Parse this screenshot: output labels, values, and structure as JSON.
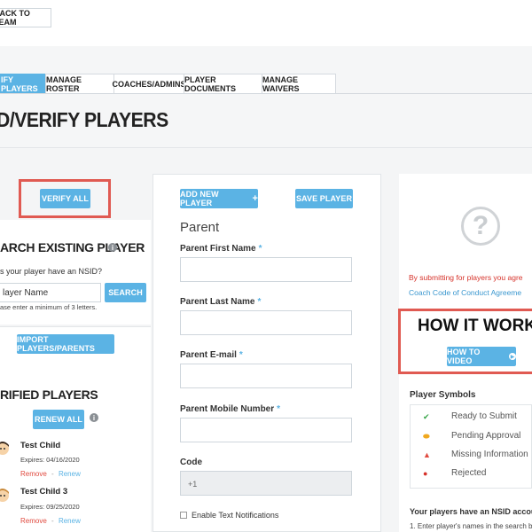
{
  "header": {
    "back_label": "BACK TO TEAM"
  },
  "tabs": [
    {
      "label": "IFY PLAYERS",
      "active": true
    },
    {
      "label": "MANAGE ROSTER",
      "active": false
    },
    {
      "label": "COACHES/ADMINS",
      "active": false
    },
    {
      "label": "PLAYER DOCUMENTS",
      "active": false
    },
    {
      "label": "MANAGE WAIVERS",
      "active": false
    }
  ],
  "page_title": "D/VERIFY PLAYERS",
  "left": {
    "verify_all_label": "VERIFY ALL",
    "search_heading": "ARCH EXISTING PLAYER",
    "nsid_question": "s your player have an NSID?",
    "search_placeholder": "layer Name",
    "search_button": "SEARCH",
    "hint": "ase enter a minimum of 3 letters.",
    "import_label": "IMPORT PLAYERS/PARENTS",
    "verified_heading": "RIFIED PLAYERS",
    "renew_all_label": "RENEW ALL",
    "players": [
      {
        "name": "Test Child",
        "expires": "Expires: 04/16/2020",
        "remove": "Remove",
        "sep": "-",
        "renew": "Renew"
      },
      {
        "name": "Test Child 3",
        "expires": "Expires: 09/25/2020",
        "remove": "Remove",
        "sep": "-",
        "renew": "Renew"
      }
    ]
  },
  "middle": {
    "add_player_label": "ADD NEW PLAYER",
    "plus": "+",
    "save_player_label": "SAVE PLAYER",
    "section_title": "Parent",
    "fields": {
      "first_name": "Parent First Name",
      "last_name": "Parent Last Name",
      "email": "Parent E-mail",
      "mobile": "Parent Mobile Number",
      "code": "Code",
      "code_value": "+1",
      "required_mark": "*"
    },
    "text_notifications": "Enable Text Notifications"
  },
  "right": {
    "question_mark": "?",
    "agree_text": "By submitting for players you agre",
    "coc_link": "Coach Code of Conduct Agreeme",
    "how_it_works": "HOW IT WORK",
    "how_to_video": "HOW TO VIDEO",
    "symbols_heading": "Player Symbols",
    "symbols": [
      {
        "icon": "✔",
        "label": "Ready to Submit",
        "color": "#3aa64a"
      },
      {
        "icon": "⬬",
        "label": "Pending Approval",
        "color": "#f0a81e"
      },
      {
        "icon": "▲",
        "label": "Missing Information",
        "color": "#e04a3f"
      },
      {
        "icon": "●",
        "label": "Rejected",
        "color": "#d6322a"
      }
    ],
    "nsid_heading": "Your players have an NSID accou",
    "nsid_step": "1. Enter player's names in the search bo"
  },
  "colors": {
    "accent": "#5bb3e4",
    "highlight": "#e05a52"
  }
}
